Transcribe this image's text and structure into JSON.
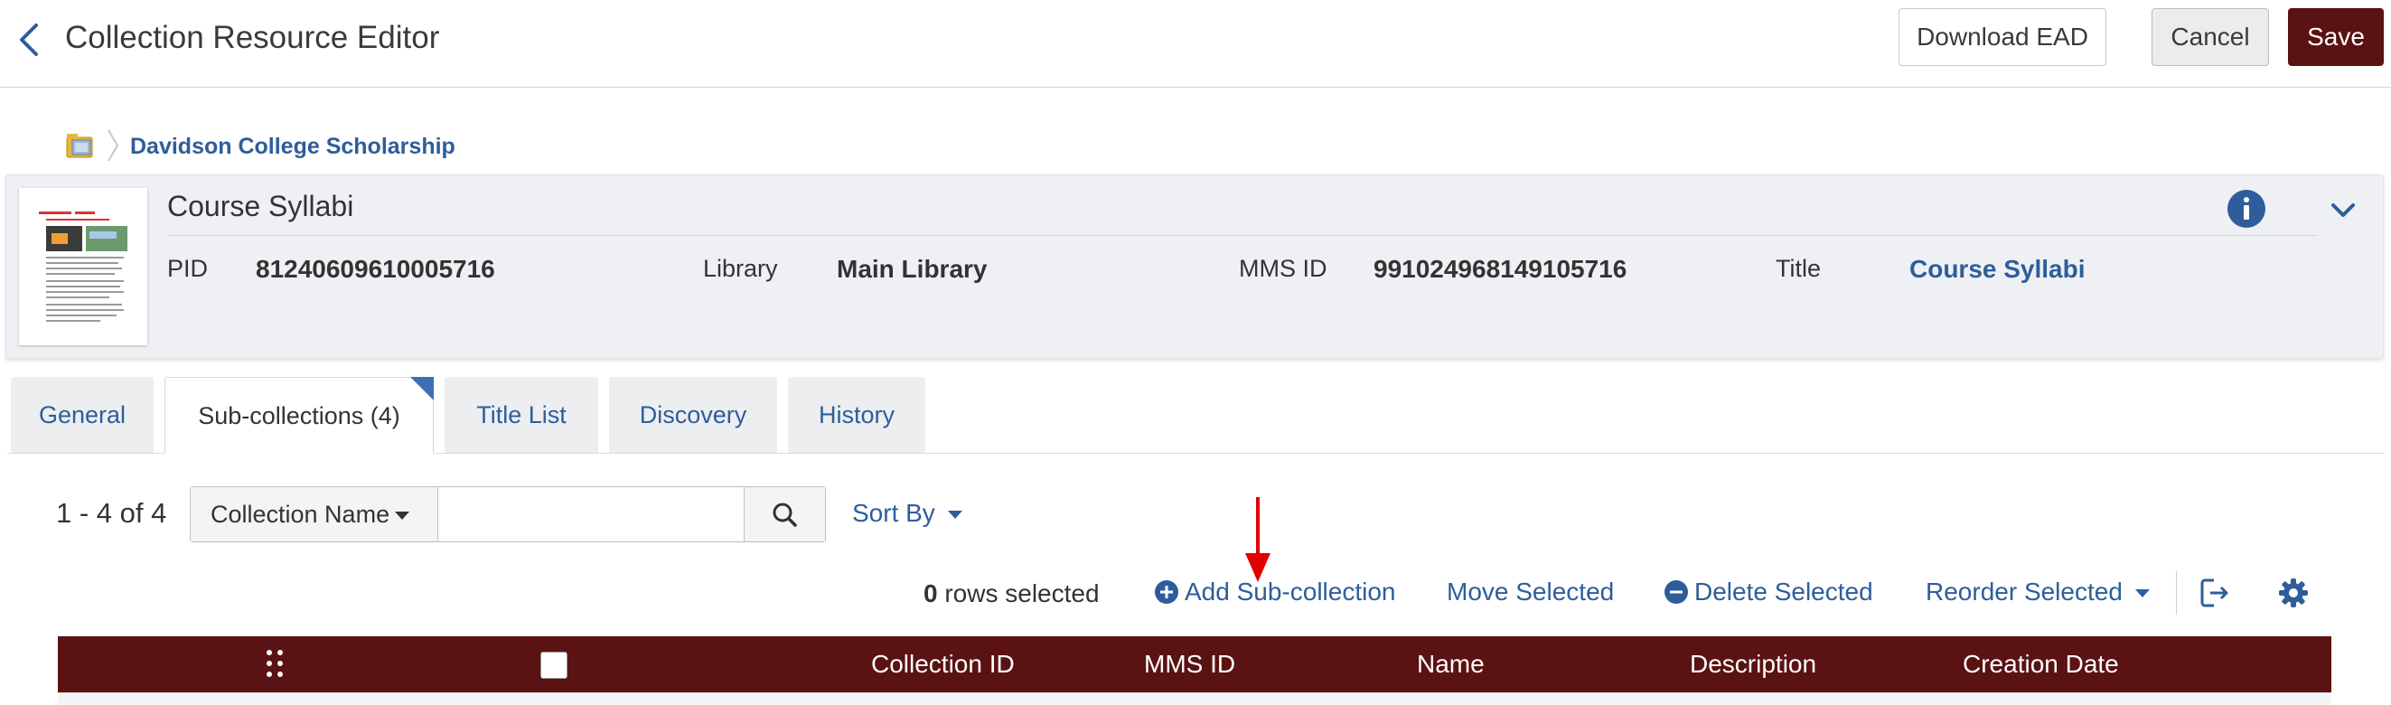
{
  "header": {
    "title": "Collection Resource Editor",
    "download_label": "Download EAD",
    "cancel_label": "Cancel",
    "save_label": "Save"
  },
  "breadcrumb": {
    "link": "Davidson College Scholarship"
  },
  "record": {
    "title": "Course Syllabi",
    "fields": {
      "pid_label": "PID",
      "pid_value": "81240609610005716",
      "library_label": "Library",
      "library_value": "Main Library",
      "mms_label": "MMS ID",
      "mms_value": "991024968149105716",
      "title_label": "Title",
      "title_value": "Course Syllabi"
    }
  },
  "tabs": [
    {
      "label": "General",
      "active": false
    },
    {
      "label": "Sub-collections (4)",
      "active": true
    },
    {
      "label": "Title List",
      "active": false
    },
    {
      "label": "Discovery",
      "active": false
    },
    {
      "label": "History",
      "active": false
    }
  ],
  "toolbar": {
    "count": "1 - 4 of 4",
    "search_field": "Collection Name",
    "search_value": "",
    "sort_label": "Sort By",
    "rows_selected_count": "0",
    "rows_selected_text": "rows selected",
    "add_label": "Add Sub-collection",
    "move_label": "Move Selected",
    "delete_label": "Delete Selected",
    "reorder_label": "Reorder Selected"
  },
  "table": {
    "columns": [
      "Collection ID",
      "MMS ID",
      "Name",
      "Description",
      "Creation Date"
    ]
  },
  "colors": {
    "brand": "#5b1212",
    "link": "#2e5d9b",
    "annotation": "#e00000"
  }
}
